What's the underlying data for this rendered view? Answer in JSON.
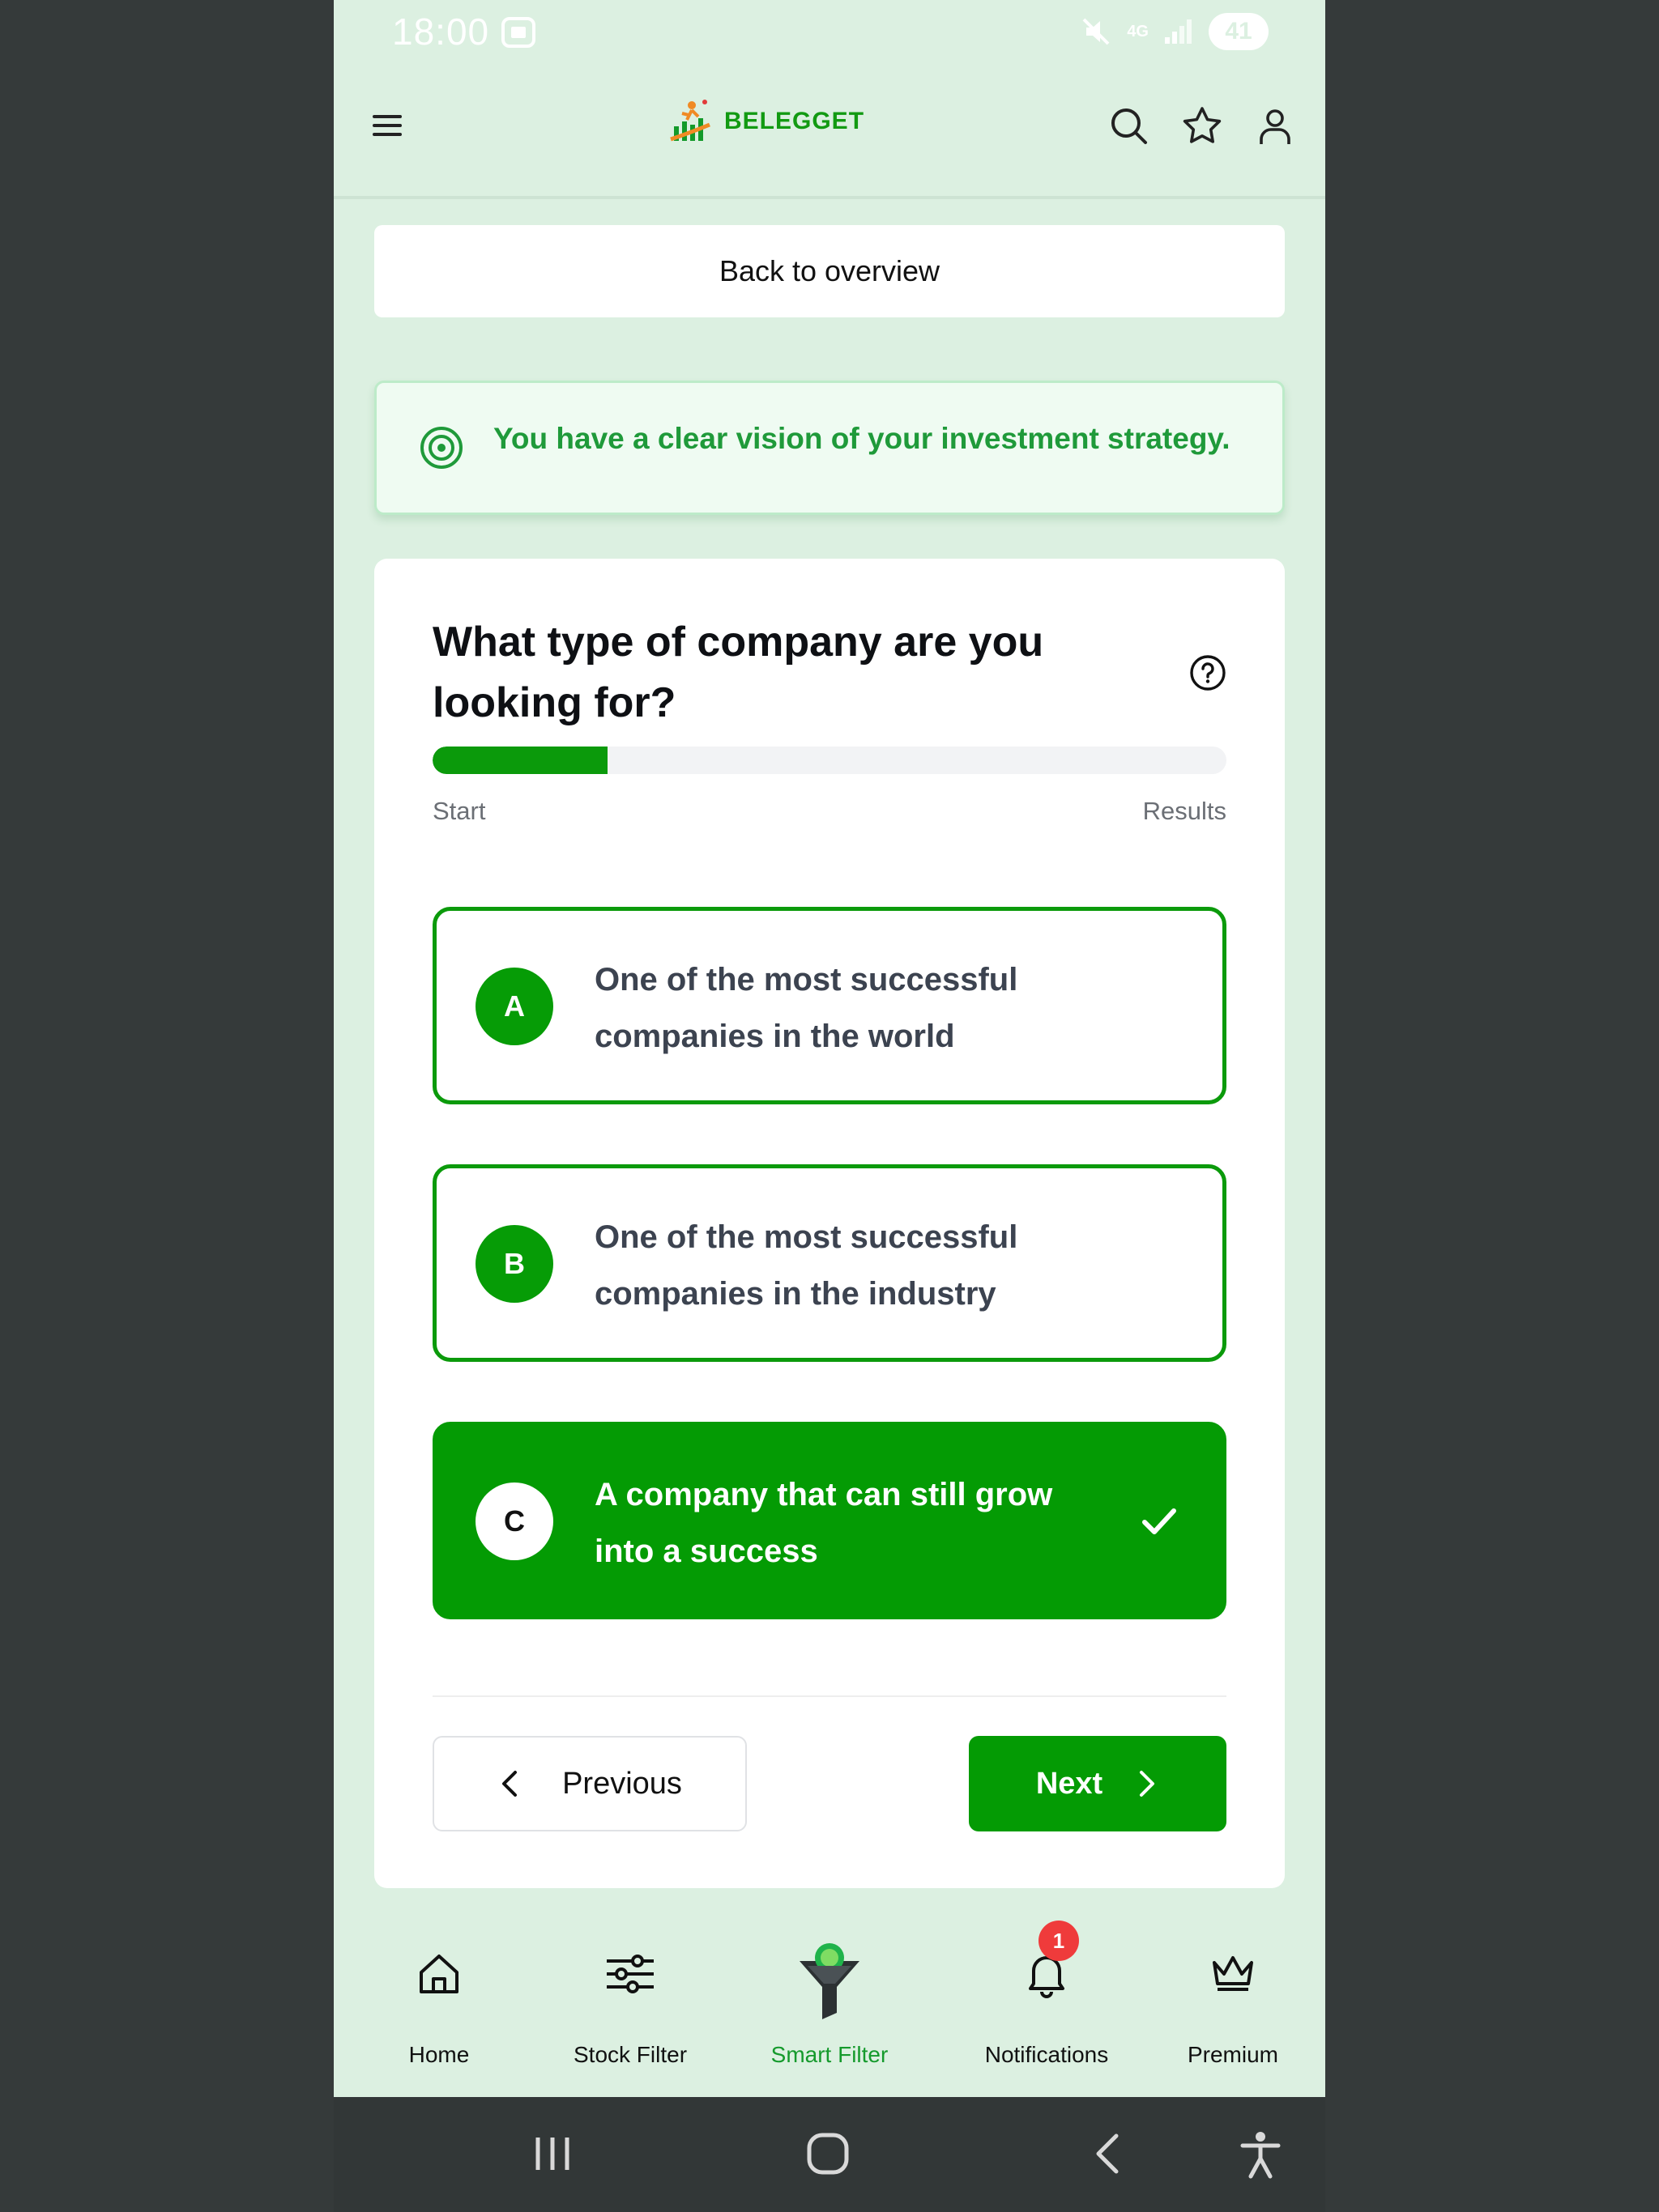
{
  "status_bar": {
    "time": "18:00",
    "network": "4G",
    "battery": "41"
  },
  "header": {
    "brand": "BELEGGET"
  },
  "back_link": "Back to overview",
  "banner": {
    "text": "You have a clear vision of your investment strategy."
  },
  "quiz": {
    "question": "What type of company are you looking for?",
    "progress": 0.22,
    "progress_start_label": "Start",
    "progress_end_label": "Results",
    "options": [
      {
        "letter": "A",
        "text": "One of the most successful companies in the world",
        "selected": false
      },
      {
        "letter": "B",
        "text": "One of the most successful companies in the industry",
        "selected": false
      },
      {
        "letter": "C",
        "text": "A company that can still grow into a success",
        "selected": true
      }
    ],
    "previous_label": "Previous",
    "next_label": "Next"
  },
  "bottom_nav": {
    "items": [
      {
        "label": "Home",
        "icon": "home-icon"
      },
      {
        "label": "Stock Filter",
        "icon": "sliders-icon"
      },
      {
        "label": "Smart Filter",
        "icon": "funnel-icon",
        "active": true
      },
      {
        "label": "Notifications",
        "icon": "bell-icon",
        "badge": "1"
      },
      {
        "label": "Premium",
        "icon": "crown-icon"
      }
    ]
  },
  "colors": {
    "brand_green": "#049b04",
    "page_bg": "#dcf0e1",
    "banner_text": "#1f9a3a",
    "badge_red": "#ef3b3b"
  }
}
